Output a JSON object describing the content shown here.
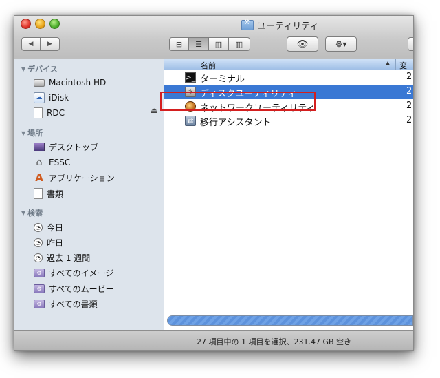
{
  "window": {
    "title": "ユーティリティ"
  },
  "toolbar": {
    "back_icon": "◀",
    "forward_icon": "▶",
    "view_icon_mode": "⊞",
    "view_list_mode": "☰",
    "view_column_mode": "▥",
    "view_coverflow_mode": "▥",
    "quicklook_icon": "👁",
    "action_icon": "⚙▾"
  },
  "sidebar": {
    "devices_header": "デバイス",
    "devices": [
      {
        "label": "Macintosh HD",
        "icon": "hard-drive-icon"
      },
      {
        "label": "iDisk",
        "icon": "idisk-icon"
      },
      {
        "label": "RDC",
        "icon": "document-icon"
      }
    ],
    "eject_icon": "⏏",
    "places_header": "場所",
    "places": [
      {
        "label": "デスクトップ",
        "icon": "desktop-icon"
      },
      {
        "label": "ESSC",
        "icon": "home-icon"
      },
      {
        "label": "アプリケーション",
        "icon": "applications-icon"
      },
      {
        "label": "書類",
        "icon": "documents-icon"
      }
    ],
    "search_header": "検索",
    "searches": [
      {
        "label": "今日",
        "icon": "clock-icon"
      },
      {
        "label": "昨日",
        "icon": "clock-icon"
      },
      {
        "label": "過去 1 週間",
        "icon": "clock-icon"
      },
      {
        "label": "すべてのイメージ",
        "icon": "smart-folder-icon"
      },
      {
        "label": "すべてのムービー",
        "icon": "smart-folder-icon"
      },
      {
        "label": "すべての書類",
        "icon": "smart-folder-icon"
      }
    ]
  },
  "list": {
    "col_name": "名前",
    "col_sort_icon": "▲",
    "col_next": "変",
    "rows": [
      {
        "name": "ターミナル",
        "date": "2",
        "selected": false
      },
      {
        "name": "ディスクユーティリティ",
        "date": "2",
        "selected": true
      },
      {
        "name": "ネットワークユーティリティ",
        "date": "2",
        "selected": false
      },
      {
        "name": "移行アシスタント",
        "date": "2",
        "selected": false
      }
    ]
  },
  "status": {
    "text": "27 項目中の 1 項目を選択、231.47 GB 空き"
  },
  "colors": {
    "selection": "#3a78d4",
    "highlight_box": "#d41f1f",
    "sidebar_bg": "#dde4ec"
  }
}
